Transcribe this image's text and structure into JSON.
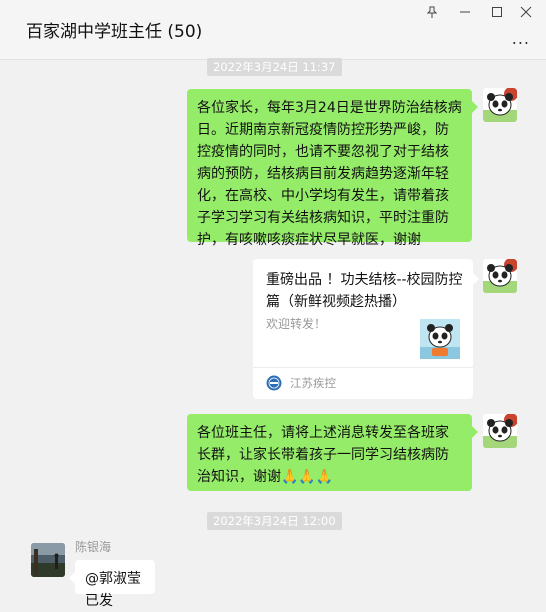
{
  "window": {
    "title": "百家湖中学班主任 (50)",
    "controls": [
      "pin-icon",
      "minimize-icon",
      "maximize-icon",
      "close-icon"
    ],
    "more_label": "..."
  },
  "messages": [
    {
      "type": "timestamp",
      "text": "2022年3月24日 11:37"
    },
    {
      "type": "text",
      "side": "right",
      "text": "各位家长，每年3月24日是世界防治结核病日。近期南京新冠疫情防控形势严峻，防控疫情的同时，也请不要忽视了对于结核病的预防，结核病目前发病趋势逐渐年轻化，在高校、中小学均有发生，请带着孩子学习学习有关结核病知识，平时注重防护，有咳嗽咳痰症状尽早就医，谢谢"
    },
    {
      "type": "link_card",
      "side": "right",
      "title": "重磅出品 ！功夫结核--校园防控篇（新鲜视频趁热播）",
      "description": "欢迎转发！",
      "source": "江苏疾控",
      "thumb_icon": "panda-icon",
      "source_icon": "jiangsu-cdc-logo-icon"
    },
    {
      "type": "text",
      "side": "right",
      "text": "各位班主任，请将上述消息转发至各班家长群，让家长带着孩子一同学习结核病防治知识，谢谢🙏🙏🙏"
    },
    {
      "type": "timestamp",
      "text": "2022年3月24日 12:00"
    },
    {
      "type": "text",
      "side": "left",
      "sender": "陈银海",
      "text": "@郭淑莹 已发"
    }
  ],
  "colors": {
    "self_bubble": "#95ec69",
    "other_bubble": "#ffffff",
    "background": "#f1f1f1",
    "timestamp_bg": "#dadada"
  }
}
